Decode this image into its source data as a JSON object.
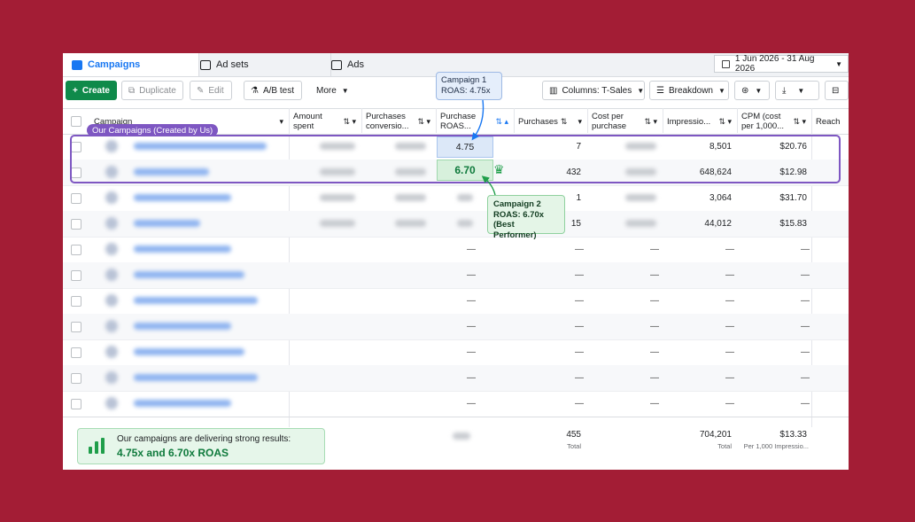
{
  "tabs": [
    {
      "label": "Campaigns",
      "icon": "campaigns-icon"
    },
    {
      "label": "Ad sets",
      "icon": "grid-icon"
    },
    {
      "label": "Ads",
      "icon": "ad-icon"
    }
  ],
  "date_range": "1 Jun 2026 - 31 Aug 2026",
  "toolbar": {
    "create": "Create",
    "duplicate": "Duplicate",
    "edit": "Edit",
    "ab_test": "A/B test",
    "more": "More",
    "columns": "Columns: T-Sales",
    "breakdown": "Breakdown"
  },
  "columns": {
    "campaign": "Campaign",
    "amount_spent": [
      "Amount",
      "spent"
    ],
    "purchases_conv": [
      "Purchases",
      "conversio..."
    ],
    "purchase_roas": [
      "Purchase",
      "ROAS..."
    ],
    "purchases": "Purchases",
    "cost_per_purchase": [
      "Cost per",
      "purchase"
    ],
    "impressions": "Impressio...",
    "cpm": [
      "CPM (cost",
      "per 1,000..."
    ],
    "reach": "Reach"
  },
  "highlight_label": "Our Campaigns (Created by Us)",
  "rows": [
    {
      "roas": "4.75",
      "purchases": "7",
      "impressions": "8,501",
      "cpm": "$20.76"
    },
    {
      "roas": "6.70",
      "purchases": "432",
      "impressions": "648,624",
      "cpm": "$12.98"
    },
    {
      "roas": "",
      "purchases": "1",
      "impressions": "3,064",
      "cpm": "$31.70"
    },
    {
      "roas": "",
      "purchases": "15",
      "impressions": "44,012",
      "cpm": "$15.83"
    }
  ],
  "dash": "—",
  "callout1": {
    "line1": "Campaign 1",
    "line2": "ROAS: 4.75x"
  },
  "callout2": {
    "line1": "Campaign 2",
    "line2": "ROAS: 6.70x",
    "line3": "(Best Performer)"
  },
  "footer": {
    "badge_line1": "Our campaigns are delivering strong results:",
    "badge_line2": "4.75x and 6.70x ROAS",
    "purchases_total": "455",
    "purchases_sub": "Total",
    "impressions_total": "704,201",
    "impressions_sub": "Total",
    "cpm_total": "$13.33",
    "cpm_sub": "Per 1,000 Impressio..."
  },
  "colors": {
    "background": "#a31d35",
    "accent": "#7e57c2",
    "create": "#0f8a4a",
    "best": "#0f7a3c"
  }
}
